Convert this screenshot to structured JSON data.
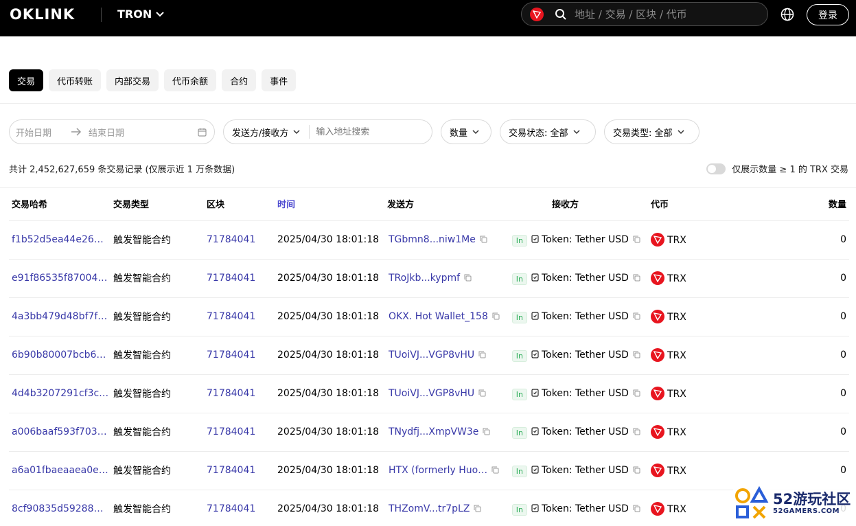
{
  "header": {
    "logo": "OKLINK",
    "chain": "TRON",
    "search_placeholder": "地址 / 交易 / 区块 / 代币",
    "login": "登录"
  },
  "tabs": [
    {
      "label": "交易",
      "active": true
    },
    {
      "label": "代币转账",
      "active": false
    },
    {
      "label": "内部交易",
      "active": false
    },
    {
      "label": "代币余额",
      "active": false
    },
    {
      "label": "合约",
      "active": false
    },
    {
      "label": "事件",
      "active": false
    }
  ],
  "filters": {
    "start_date": "开始日期",
    "end_date": "结束日期",
    "party_select": "发送方/接收方",
    "address_placeholder": "输入地址搜索",
    "amount": "数量",
    "status": "交易状态: 全部",
    "type": "交易类型: 全部"
  },
  "summary": {
    "count_text": "共计 2,452,627,659 条交易记录 (仅展示近 1 万条数据)",
    "toggle_label": "仅展示数量 ≥ 1 的 TRX 交易"
  },
  "table": {
    "headers": [
      "交易哈希",
      "交易类型",
      "区块",
      "时间",
      "发送方",
      "接收方",
      "代币",
      "数量"
    ],
    "rows": [
      {
        "hash": "f1b52d5ea44e26…",
        "type": "触发智能合约",
        "block": "71784041",
        "time": "2025/04/30 18:01:18",
        "from": "TGbmn8...niw1Me",
        "dir": "In",
        "to": "Token: Tether USD",
        "token": "TRX",
        "amount": "0"
      },
      {
        "hash": "e91f86535f87004…",
        "type": "触发智能合约",
        "block": "71784041",
        "time": "2025/04/30 18:01:18",
        "from": "TRoJkb...kypmf",
        "dir": "In",
        "to": "Token: Tether USD",
        "token": "TRX",
        "amount": "0"
      },
      {
        "hash": "4a3bb479d48bf7f…",
        "type": "触发智能合约",
        "block": "71784041",
        "time": "2025/04/30 18:01:18",
        "from": "OKX. Hot Wallet_158",
        "dir": "In",
        "to": "Token: Tether USD",
        "token": "TRX",
        "amount": "0"
      },
      {
        "hash": "6b90b80007bcb6…",
        "type": "触发智能合约",
        "block": "71784041",
        "time": "2025/04/30 18:01:18",
        "from": "TUoiVJ...VGP8vHU",
        "dir": "In",
        "to": "Token: Tether USD",
        "token": "TRX",
        "amount": "0"
      },
      {
        "hash": "4d4b3207291cf3c…",
        "type": "触发智能合约",
        "block": "71784041",
        "time": "2025/04/30 18:01:18",
        "from": "TUoiVJ...VGP8vHU",
        "dir": "In",
        "to": "Token: Tether USD",
        "token": "TRX",
        "amount": "0"
      },
      {
        "hash": "a006baaf593f703…",
        "type": "触发智能合约",
        "block": "71784041",
        "time": "2025/04/30 18:01:18",
        "from": "TNydfj...XmpVW3e",
        "dir": "In",
        "to": "Token: Tether USD",
        "token": "TRX",
        "amount": "0"
      },
      {
        "hash": "a6a01fbaeaaea0e…",
        "type": "触发智能合约",
        "block": "71784041",
        "time": "2025/04/30 18:01:18",
        "from": "HTX (formerly Huo…",
        "dir": "In",
        "to": "Token: Tether USD",
        "token": "TRX",
        "amount": "0"
      },
      {
        "hash": "8cf90835d59288…",
        "type": "触发智能合约",
        "block": "71784041",
        "time": "2025/04/30 18:01:18",
        "from": "THZomV...tr7pLZ",
        "dir": "In",
        "to": "Token: Tether USD",
        "token": "TRX",
        "amount": "0"
      }
    ]
  },
  "watermark": {
    "title": "52游玩社区",
    "site": "52GAMERS.COM"
  },
  "colors": {
    "link": "#3838a8",
    "time_header": "#4c4ad0",
    "tron_red": "#e8151f",
    "in_green": "#2fae5b"
  }
}
